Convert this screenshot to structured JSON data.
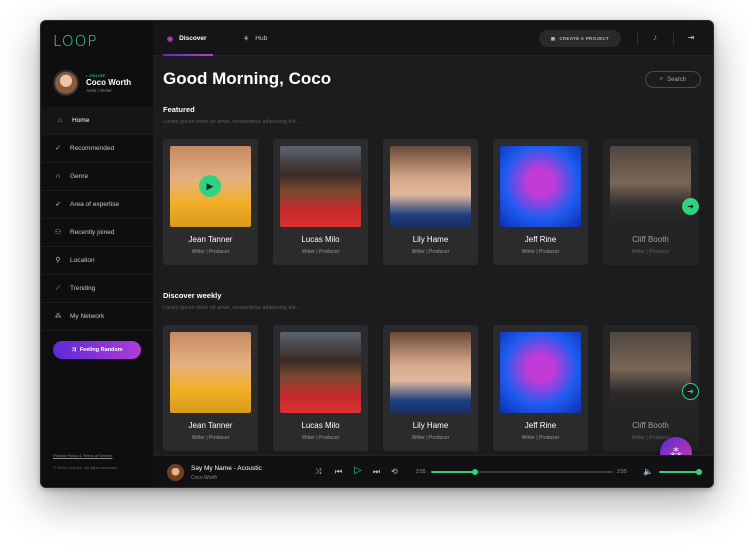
{
  "app": {
    "logo": "LOOP"
  },
  "profile": {
    "status": "• ONLINE",
    "name": "Coco Worth",
    "role": "Artist | Writer"
  },
  "sidebar": {
    "items": [
      {
        "label": "Home",
        "icon": "home-icon",
        "glyph": "⌂",
        "active": true
      },
      {
        "label": "Recommended",
        "icon": "thumbs-up-icon",
        "glyph": "👍"
      },
      {
        "label": "Genre",
        "icon": "headphones-icon",
        "glyph": "◠"
      },
      {
        "label": "Area of expertise",
        "icon": "rocket-icon",
        "glyph": "➶"
      },
      {
        "label": "Recently joined",
        "icon": "users-icon",
        "glyph": "⚇"
      },
      {
        "label": "Location",
        "icon": "location-pin-icon",
        "glyph": "⚲"
      },
      {
        "label": "Trending",
        "icon": "trending-chart-icon",
        "glyph": "⟋"
      },
      {
        "label": "My Network",
        "icon": "network-icon",
        "glyph": "⁂"
      }
    ],
    "feeling_random": "Feeling Random",
    "footer_links": "Privacy Policy & Terms of Service",
    "copyright": "© 2020 Loop Inc. All rights reserved."
  },
  "topbar": {
    "tabs": [
      {
        "label": "Discover",
        "active": true
      },
      {
        "label": "Hub"
      }
    ],
    "create_project": "CREATE A PROJECT"
  },
  "main": {
    "greeting": "Good Morning, Coco",
    "search_label": "Search",
    "featured": {
      "title": "Featured",
      "subtitle": "Lorem ipsum dolor sit amet, consectetur adipiscing elit...",
      "cards": [
        {
          "name": "Jean Tanner",
          "role": "Writer | Producer"
        },
        {
          "name": "Lucas Milo",
          "role": "Writer | Producer"
        },
        {
          "name": "Lily Hame",
          "role": "Writer | Producer"
        },
        {
          "name": "Jeff Rine",
          "role": "Writer | Producer"
        },
        {
          "name": "Cliff Booth",
          "role": "Writer | Producer"
        }
      ]
    },
    "weekly": {
      "title": "Discover weekly",
      "subtitle": "Lorem ipsum dolor sit amet, consectetur adipiscing elit...",
      "cards": [
        {
          "name": "Jean Tanner",
          "role": "Writer | Producer"
        },
        {
          "name": "Lucas Milo",
          "role": "Writer | Producer"
        },
        {
          "name": "Lily Hame",
          "role": "Writer | Producer"
        },
        {
          "name": "Jeff Rine",
          "role": "Writer | Producer"
        },
        {
          "name": "Cliff Booth",
          "role": "Writer | Producer"
        }
      ]
    }
  },
  "player": {
    "song": "Say My Name - Acoustic",
    "artist": "Coco Worth",
    "time_elapsed": "2:55",
    "time_total": "2:55",
    "progress": 0.24,
    "volume": 1.0
  },
  "colors": {
    "accent": "#2fd37f",
    "gradient_start": "#5b2bd6",
    "gradient_end": "#c23cc0",
    "background": "#1c1c1e"
  }
}
